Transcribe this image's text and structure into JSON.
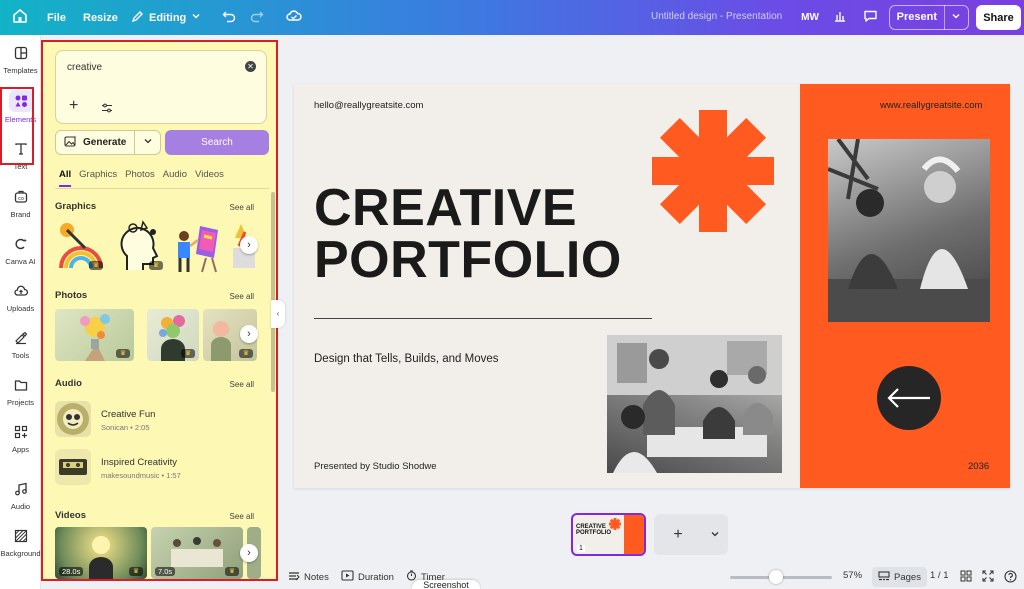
{
  "topbar": {
    "home_icon": "home-icon",
    "file_label": "File",
    "resize_label": "Resize",
    "editing_label": "Editing",
    "design_title": "Untitled design - Presentation",
    "avatar_initials": "MW",
    "present_label": "Present",
    "share_label": "Share"
  },
  "rail": {
    "items": [
      {
        "label": "Templates",
        "icon": "templates-icon"
      },
      {
        "label": "Elements",
        "icon": "elements-icon"
      },
      {
        "label": "Text",
        "icon": "text-icon"
      },
      {
        "label": "Brand",
        "icon": "brand-icon"
      },
      {
        "label": "Canva AI",
        "icon": "canva-ai-icon"
      },
      {
        "label": "Uploads",
        "icon": "uploads-icon"
      },
      {
        "label": "Tools",
        "icon": "tools-icon"
      },
      {
        "label": "Projects",
        "icon": "projects-icon"
      },
      {
        "label": "Apps",
        "icon": "apps-icon"
      },
      {
        "label": "Audio",
        "icon": "audio-icon"
      },
      {
        "label": "Background",
        "icon": "background-icon"
      }
    ]
  },
  "panel": {
    "search_value": "creative",
    "generate_label": "Generate",
    "search_button": "Search",
    "tabs": [
      "All",
      "Graphics",
      "Photos",
      "Audio",
      "Videos"
    ],
    "active_tab": "All",
    "see_all": "See all",
    "sections": {
      "graphics": "Graphics",
      "photos": "Photos",
      "audio": "Audio",
      "videos": "Videos"
    },
    "audio_tracks": [
      {
        "title": "Creative Fun",
        "subtitle": "Sonican • 2:05"
      },
      {
        "title": "Inspired Creativity",
        "subtitle": "makesoundmusic • 1:57"
      }
    ],
    "videos": [
      {
        "duration": "28.0s"
      },
      {
        "duration": "7.0s"
      }
    ]
  },
  "slide": {
    "email": "hello@reallygreatsite.com",
    "url": "www.reallygreatsite.com",
    "title_line1": "CREATIVE",
    "title_line2": "PORTFOLIO",
    "tagline": "Design that Tells, Builds, and Moves",
    "presented_by": "Presented by Studio Shodwe",
    "year": "2036"
  },
  "pages": {
    "thumb_title": "CREATIVE PORTFOLIO",
    "thumb_number": "1"
  },
  "bottombar": {
    "notes_label": "Notes",
    "duration_label": "Duration",
    "timer_label": "Timer",
    "tooltip": "Screenshot",
    "zoom_level": "57%",
    "zoom_fraction": 0.57,
    "pages_label": "Pages",
    "page_count": "1 / 1"
  },
  "colors": {
    "accent_orange": "#ff5a1f",
    "panel_highlight": "#fdf8b4",
    "annotation_red": "#d61f26",
    "primary_purple": "#a67fe3"
  }
}
